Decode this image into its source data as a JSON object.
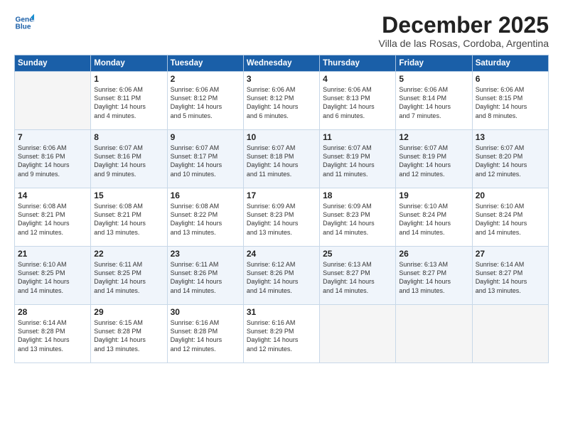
{
  "logo": {
    "line1": "General",
    "line2": "Blue"
  },
  "title": "December 2025",
  "location": "Villa de las Rosas, Cordoba, Argentina",
  "weekdays": [
    "Sunday",
    "Monday",
    "Tuesday",
    "Wednesday",
    "Thursday",
    "Friday",
    "Saturday"
  ],
  "weeks": [
    [
      {
        "day": "",
        "info": ""
      },
      {
        "day": "1",
        "info": "Sunrise: 6:06 AM\nSunset: 8:11 PM\nDaylight: 14 hours\nand 4 minutes."
      },
      {
        "day": "2",
        "info": "Sunrise: 6:06 AM\nSunset: 8:12 PM\nDaylight: 14 hours\nand 5 minutes."
      },
      {
        "day": "3",
        "info": "Sunrise: 6:06 AM\nSunset: 8:12 PM\nDaylight: 14 hours\nand 6 minutes."
      },
      {
        "day": "4",
        "info": "Sunrise: 6:06 AM\nSunset: 8:13 PM\nDaylight: 14 hours\nand 6 minutes."
      },
      {
        "day": "5",
        "info": "Sunrise: 6:06 AM\nSunset: 8:14 PM\nDaylight: 14 hours\nand 7 minutes."
      },
      {
        "day": "6",
        "info": "Sunrise: 6:06 AM\nSunset: 8:15 PM\nDaylight: 14 hours\nand 8 minutes."
      }
    ],
    [
      {
        "day": "7",
        "info": "Sunrise: 6:06 AM\nSunset: 8:16 PM\nDaylight: 14 hours\nand 9 minutes."
      },
      {
        "day": "8",
        "info": "Sunrise: 6:07 AM\nSunset: 8:16 PM\nDaylight: 14 hours\nand 9 minutes."
      },
      {
        "day": "9",
        "info": "Sunrise: 6:07 AM\nSunset: 8:17 PM\nDaylight: 14 hours\nand 10 minutes."
      },
      {
        "day": "10",
        "info": "Sunrise: 6:07 AM\nSunset: 8:18 PM\nDaylight: 14 hours\nand 11 minutes."
      },
      {
        "day": "11",
        "info": "Sunrise: 6:07 AM\nSunset: 8:19 PM\nDaylight: 14 hours\nand 11 minutes."
      },
      {
        "day": "12",
        "info": "Sunrise: 6:07 AM\nSunset: 8:19 PM\nDaylight: 14 hours\nand 12 minutes."
      },
      {
        "day": "13",
        "info": "Sunrise: 6:07 AM\nSunset: 8:20 PM\nDaylight: 14 hours\nand 12 minutes."
      }
    ],
    [
      {
        "day": "14",
        "info": "Sunrise: 6:08 AM\nSunset: 8:21 PM\nDaylight: 14 hours\nand 12 minutes."
      },
      {
        "day": "15",
        "info": "Sunrise: 6:08 AM\nSunset: 8:21 PM\nDaylight: 14 hours\nand 13 minutes."
      },
      {
        "day": "16",
        "info": "Sunrise: 6:08 AM\nSunset: 8:22 PM\nDaylight: 14 hours\nand 13 minutes."
      },
      {
        "day": "17",
        "info": "Sunrise: 6:09 AM\nSunset: 8:23 PM\nDaylight: 14 hours\nand 13 minutes."
      },
      {
        "day": "18",
        "info": "Sunrise: 6:09 AM\nSunset: 8:23 PM\nDaylight: 14 hours\nand 14 minutes."
      },
      {
        "day": "19",
        "info": "Sunrise: 6:10 AM\nSunset: 8:24 PM\nDaylight: 14 hours\nand 14 minutes."
      },
      {
        "day": "20",
        "info": "Sunrise: 6:10 AM\nSunset: 8:24 PM\nDaylight: 14 hours\nand 14 minutes."
      }
    ],
    [
      {
        "day": "21",
        "info": "Sunrise: 6:10 AM\nSunset: 8:25 PM\nDaylight: 14 hours\nand 14 minutes."
      },
      {
        "day": "22",
        "info": "Sunrise: 6:11 AM\nSunset: 8:25 PM\nDaylight: 14 hours\nand 14 minutes."
      },
      {
        "day": "23",
        "info": "Sunrise: 6:11 AM\nSunset: 8:26 PM\nDaylight: 14 hours\nand 14 minutes."
      },
      {
        "day": "24",
        "info": "Sunrise: 6:12 AM\nSunset: 8:26 PM\nDaylight: 14 hours\nand 14 minutes."
      },
      {
        "day": "25",
        "info": "Sunrise: 6:13 AM\nSunset: 8:27 PM\nDaylight: 14 hours\nand 14 minutes."
      },
      {
        "day": "26",
        "info": "Sunrise: 6:13 AM\nSunset: 8:27 PM\nDaylight: 14 hours\nand 13 minutes."
      },
      {
        "day": "27",
        "info": "Sunrise: 6:14 AM\nSunset: 8:27 PM\nDaylight: 14 hours\nand 13 minutes."
      }
    ],
    [
      {
        "day": "28",
        "info": "Sunrise: 6:14 AM\nSunset: 8:28 PM\nDaylight: 14 hours\nand 13 minutes."
      },
      {
        "day": "29",
        "info": "Sunrise: 6:15 AM\nSunset: 8:28 PM\nDaylight: 14 hours\nand 13 minutes."
      },
      {
        "day": "30",
        "info": "Sunrise: 6:16 AM\nSunset: 8:28 PM\nDaylight: 14 hours\nand 12 minutes."
      },
      {
        "day": "31",
        "info": "Sunrise: 6:16 AM\nSunset: 8:29 PM\nDaylight: 14 hours\nand 12 minutes."
      },
      {
        "day": "",
        "info": ""
      },
      {
        "day": "",
        "info": ""
      },
      {
        "day": "",
        "info": ""
      }
    ]
  ]
}
